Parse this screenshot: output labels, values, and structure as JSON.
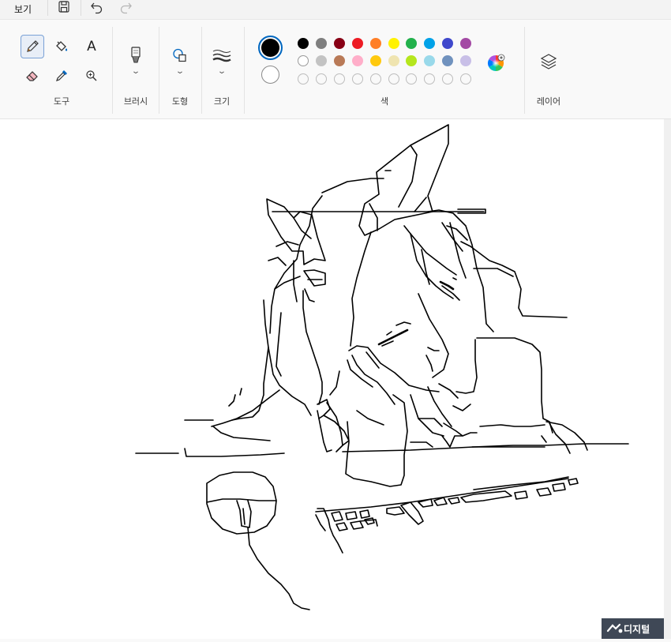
{
  "menubar": {
    "view_label": "보기"
  },
  "ribbon": {
    "groups": {
      "tools": "도구",
      "brushes": "브러시",
      "shapes": "도형",
      "size": "크기",
      "colors": "색",
      "layers": "레이어"
    },
    "text_tool_glyph": "A"
  },
  "colors": {
    "primary": "#000000",
    "secondary": "#ffffff",
    "accent": "#0067c0",
    "row1": [
      "#000000",
      "#7f7f7f",
      "#880015",
      "#ed1c24",
      "#ff7f27",
      "#fff200",
      "#22b14c",
      "#00a2e8",
      "#3f48cc",
      "#a349a4"
    ],
    "row2": [
      "#ffffff",
      "#c3c3c3",
      "#b97a57",
      "#ffaec9",
      "#ffc90e",
      "#efe4b0",
      "#b5e61d",
      "#99d9ea",
      "#7092be",
      "#c8bfe7"
    ]
  },
  "watermark": {
    "text": "디지털"
  }
}
